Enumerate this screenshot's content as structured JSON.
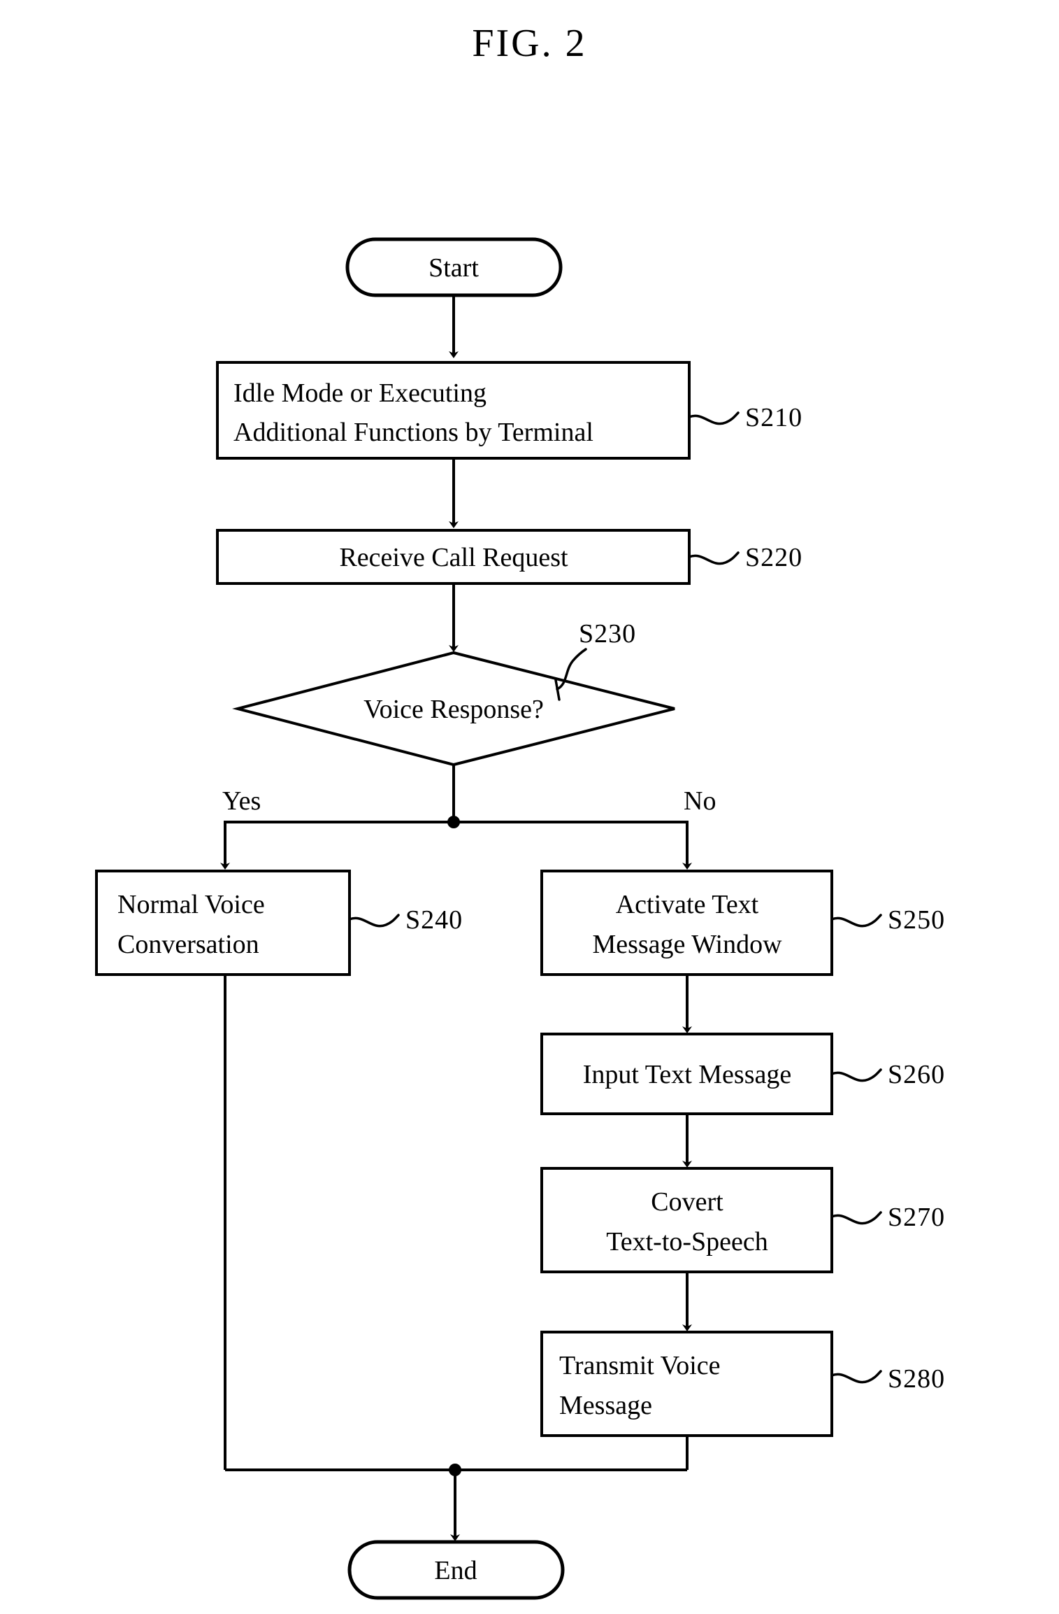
{
  "figure": {
    "title": "FIG. 2",
    "type": "flowchart",
    "background_color": "#ffffff",
    "line_color": "#000000"
  },
  "chart_data": {
    "type": "diagram",
    "title": "FIG. 2",
    "nodes": [
      {
        "id": "start",
        "shape": "terminator",
        "label": "Start",
        "ref": ""
      },
      {
        "id": "s210",
        "shape": "process",
        "label": "Idle Mode or Executing\nAdditional Functions by Terminal",
        "ref": "S210"
      },
      {
        "id": "s220",
        "shape": "process",
        "label": "Receive Call Request",
        "ref": "S220"
      },
      {
        "id": "s230",
        "shape": "decision",
        "label": "Voice Response?",
        "ref": "S230"
      },
      {
        "id": "s240",
        "shape": "process",
        "label": "Normal Voice\nConversation",
        "ref": "S240"
      },
      {
        "id": "s250",
        "shape": "process",
        "label": "Activate Text\nMessage Window",
        "ref": "S250"
      },
      {
        "id": "s260",
        "shape": "process",
        "label": "Input Text Message",
        "ref": "S260"
      },
      {
        "id": "s270",
        "shape": "process",
        "label": "Covert\nText-to-Speech",
        "ref": "S270"
      },
      {
        "id": "s280",
        "shape": "process",
        "label": "Transmit Voice\nMessage",
        "ref": "S280"
      },
      {
        "id": "end",
        "shape": "terminator",
        "label": "End",
        "ref": ""
      }
    ],
    "edges": [
      {
        "from": "start",
        "to": "s210",
        "label": ""
      },
      {
        "from": "s210",
        "to": "s220",
        "label": ""
      },
      {
        "from": "s220",
        "to": "s230",
        "label": ""
      },
      {
        "from": "s230",
        "to": "s240",
        "label": "Yes"
      },
      {
        "from": "s230",
        "to": "s250",
        "label": "No"
      },
      {
        "from": "s250",
        "to": "s260",
        "label": ""
      },
      {
        "from": "s260",
        "to": "s270",
        "label": ""
      },
      {
        "from": "s270",
        "to": "s280",
        "label": ""
      },
      {
        "from": "s240",
        "to": "end",
        "label": ""
      },
      {
        "from": "s280",
        "to": "end",
        "label": ""
      }
    ]
  },
  "nodes": {
    "start": {
      "label": "Start"
    },
    "s210": {
      "line1": "Idle Mode or Executing",
      "line2": "Additional Functions by Terminal",
      "ref": "S210"
    },
    "s220": {
      "line1": "Receive Call Request",
      "ref": "S220"
    },
    "s230": {
      "line1": "Voice Response?",
      "ref": "S230"
    },
    "s240": {
      "line1": "Normal Voice",
      "line2": "Conversation",
      "ref": "S240"
    },
    "s250": {
      "line1": "Activate Text",
      "line2": "Message Window",
      "ref": "S250"
    },
    "s260": {
      "line1": "Input Text Message",
      "ref": "S260"
    },
    "s270": {
      "line1": "Covert",
      "line2": "Text-to-Speech",
      "ref": "S270"
    },
    "s280": {
      "line1": "Transmit Voice",
      "line2": "Message",
      "ref": "S280"
    },
    "end": {
      "label": "End"
    }
  },
  "branches": {
    "yes": "Yes",
    "no": "No"
  }
}
